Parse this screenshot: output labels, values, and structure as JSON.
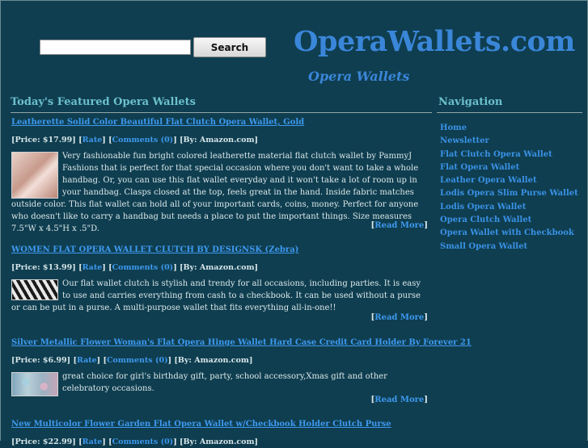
{
  "search": {
    "placeholder": "",
    "value": "",
    "button_label": "Search"
  },
  "site": {
    "title": "OperaWallets.com",
    "tagline": "Opera Wallets"
  },
  "main": {
    "heading": "Today's Featured Opera Wallets",
    "read_more_label": "Read More",
    "products": [
      {
        "title": "Leatherette Solid Color Beautiful Flat Clutch Opera Wallet, Gold",
        "price_label": "[Price: $17.99]",
        "rate_label": "Rate",
        "comments_label": "Comments (0)",
        "by_label": "[By: Amazon.com]",
        "thumbnail_icon": "pink-clutch-wallet-image",
        "description": "Very fashionable fun bright colored leatherette material flat clutch wallet by PammyJ Fashions that is perfect for that special occasion where you don't want to take a whole handbag. Or, you can use this flat wallet everyday and it won't take a lot of room up in your handbag. Clasps closed at the top, feels great in the hand. Inside fabric matches outside color. This flat wallet can hold all of your important cards, coins, money. Perfect for anyone who doesn't like to carry a handbag but needs a place to put the important things. Size measures 7.5\"W x 4.5\"H x .5\"D."
      },
      {
        "title": "WOMEN FLAT OPERA WALLET CLUTCH BY DESIGNSK (Zebra)",
        "price_label": "[Price: $13.99]",
        "rate_label": "Rate",
        "comments_label": "Comments (0)",
        "by_label": "[By: Amazon.com]",
        "thumbnail_icon": "zebra-wallet-image",
        "description": "Our flat wallet clutch is stylish and trendy for all occasions, including parties. It is easy to use and carries everything from cash to a checkbook. It can be used without a purse or can be put in a purse. A multi-purpose wallet that fits everything all-in-one!!"
      },
      {
        "title": "Silver Metallic Flower Woman's Flat Opera Hinge Wallet Hard Case Credit Card Holder By Forever 21",
        "price_label": "[Price: $6.99]",
        "rate_label": "Rate",
        "comments_label": "Comments (0)",
        "by_label": "[By: Amazon.com]",
        "thumbnail_icon": "flower-wallet-image",
        "description": "great choice for girl's birthday gift, party, school accessory,Xmas gift and other celebratory occasions."
      },
      {
        "title": "New Multicolor Flower Garden Flat Opera Wallet w/Checkbook Holder Clutch Purse",
        "price_label": "[Price: $22.99]",
        "rate_label": "Rate",
        "comments_label": "Comments (0)",
        "by_label": "[By: Amazon.com]"
      }
    ]
  },
  "nav": {
    "heading": "Navigation",
    "items": [
      "Home",
      "Newsletter",
      "Flat Clutch Opera Wallet",
      "Flat Opera Wallet",
      "Leather Opera Wallet",
      "Lodis Opera Slim Purse Wallet",
      "Lodis Opera Wallet",
      "Opera Clutch Wallet",
      "Opera Wallet with Checkbook",
      "Small Opera Wallet"
    ]
  },
  "colors": {
    "background": "#0f3e50",
    "link": "#3e99ef",
    "heading": "#6cc0ce",
    "title": "#3a86d9"
  }
}
